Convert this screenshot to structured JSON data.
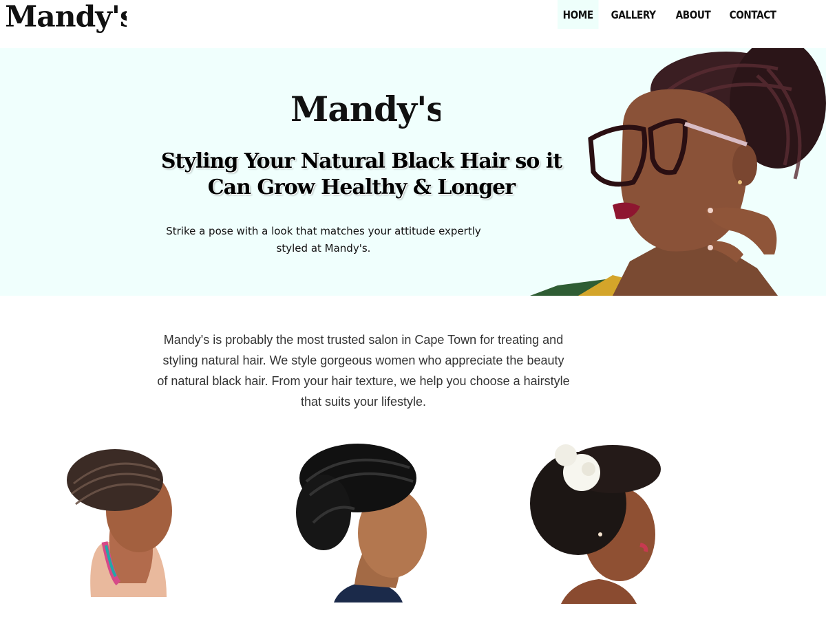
{
  "brand": {
    "name": "Mandy's"
  },
  "nav": {
    "items": [
      {
        "label": "HOME",
        "active": true
      },
      {
        "label": "GALLERY",
        "active": false
      },
      {
        "label": "ABOUT",
        "active": false
      },
      {
        "label": "CONTACT",
        "active": false
      }
    ]
  },
  "hero": {
    "title": "Styling Your Natural Black Hair so it Can Grow Healthy & Longer",
    "subtitle": "Strike a pose with a look that matches your attitude expertly styled at Mandy's."
  },
  "intro": {
    "text": "Mandy's is probably the most trusted salon in Cape Town for treating and styling natural hair. We style gorgeous women who appreciate the beauty of natural black hair. From your hair texture, we help you choose a hairstyle that suits your lifestyle."
  },
  "colors": {
    "hero_bg": "#f0fffd",
    "nav_active_bg": "#eefffb",
    "text": "#111111",
    "body_text": "#333333"
  }
}
